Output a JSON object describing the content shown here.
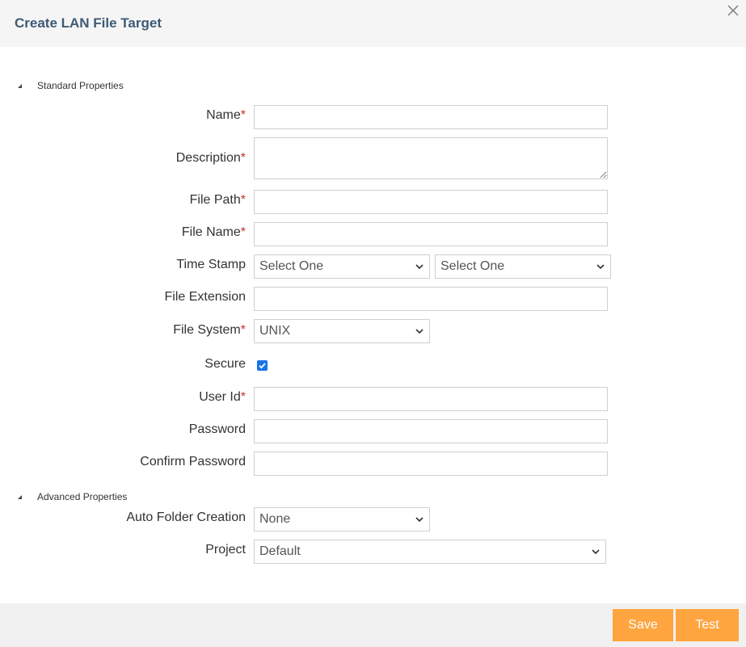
{
  "dialog": {
    "title": "Create LAN File Target",
    "close_icon": "close-icon"
  },
  "sections": {
    "standard": "Standard Properties",
    "advanced": "Advanced Properties"
  },
  "fields": {
    "name": {
      "label": "Name",
      "required": "*",
      "value": ""
    },
    "description": {
      "label": "Description",
      "required": "*",
      "value": ""
    },
    "file_path": {
      "label": "File Path",
      "required": "*",
      "value": ""
    },
    "file_name": {
      "label": "File Name",
      "required": "*",
      "value": ""
    },
    "time_stamp": {
      "label": "Time Stamp",
      "select1": "Select One",
      "select2": "Select One"
    },
    "file_extension": {
      "label": "File Extension",
      "value": ""
    },
    "file_system": {
      "label": "File System",
      "required": "*",
      "selected": "UNIX"
    },
    "secure": {
      "label": "Secure",
      "checked": true
    },
    "user_id": {
      "label": "User Id",
      "required": "*",
      "value": ""
    },
    "password": {
      "label": "Password",
      "value": ""
    },
    "confirm_password": {
      "label": "Confirm Password",
      "value": ""
    },
    "auto_folder_creation": {
      "label": "Auto Folder Creation",
      "selected": "None"
    },
    "project": {
      "label": "Project",
      "selected": "Default"
    }
  },
  "footer": {
    "save_label": "Save",
    "test_label": "Test"
  },
  "colors": {
    "title": "#3e5a76",
    "required": "#c9302c",
    "button": "#ffa53f",
    "checkbox": "#1a73e8"
  }
}
